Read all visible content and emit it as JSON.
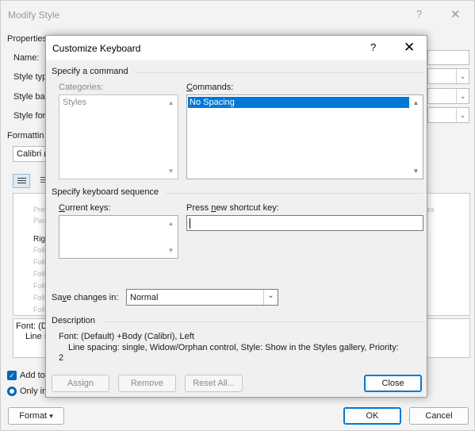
{
  "background_dialog": {
    "title": "Modify Style",
    "help_glyph": "?",
    "close_glyph": "✕",
    "properties_label": "Properties",
    "name_label": "Name:",
    "style_type_label": "Style typ",
    "style_based_label": "Style bas",
    "style_following_label": "Style for",
    "formatting_label": "Formattin",
    "font_value": "Calibri (",
    "preview_lines": [
      "Prev",
      "Para",
      "Righ",
      "Follo",
      "Follo",
      "Follo",
      "Follo",
      "Follo",
      "Follo"
    ],
    "preview_right_text": "es",
    "desc_line1": "Font: (D",
    "desc_line2": "Line s",
    "add_to_label": "Add to",
    "only_in_label": "Only in",
    "format_button": "Format",
    "format_arrow": "▾",
    "ok_button": "OK",
    "cancel_button": "Cancel"
  },
  "customize_keyboard": {
    "title": "Customize Keyboard",
    "help_glyph": "?",
    "close_glyph": "✕",
    "specify_command": {
      "heading": "Specify a command",
      "categories_label": "Categories:",
      "categories": [
        "Styles"
      ],
      "commands_label": "Commands:",
      "commands": [
        "No Spacing"
      ]
    },
    "specify_sequence": {
      "heading": "Specify keyboard sequence",
      "current_keys_label": "Current keys:",
      "current_keys": [],
      "new_shortcut_label": "Press new shortcut key:",
      "new_shortcut_value": ""
    },
    "save_changes": {
      "label": "Save changes in:",
      "value": "Normal"
    },
    "description": {
      "heading": "Description",
      "line1": "Font: (Default) +Body (Calibri), Left",
      "line2": "Line spacing:  single, Widow/Orphan control, Style: Show in the Styles gallery, Priority:",
      "line3": "2"
    },
    "buttons": {
      "assign": "Assign",
      "remove": "Remove",
      "reset_all": "Reset All...",
      "close": "Close"
    }
  },
  "icons": {
    "scroll_up": "▲",
    "scroll_down": "▼",
    "dropdown": "⌄",
    "checkmark": "✓"
  },
  "colors": {
    "selection": "#0078d7",
    "default_button_border": "#0078d4",
    "checkbox": "#0066b8"
  }
}
